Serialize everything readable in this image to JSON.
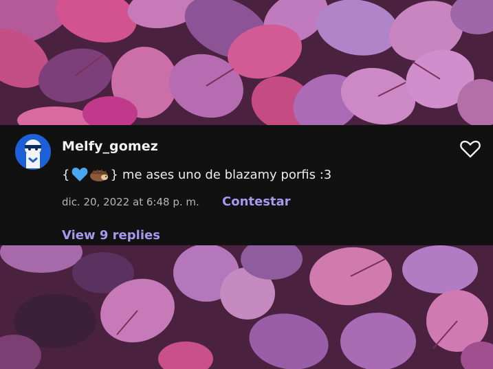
{
  "comment": {
    "username": "Melfy_gomez",
    "text_prefix": "{",
    "text_suffix": "}",
    "message": "me ases uno de blazamy porfis :3",
    "timestamp": "dic. 20, 2022 at 6:48 p. m.",
    "reply_label": "Contestar",
    "view_replies_label": "View 9 replies",
    "emojis": [
      "blue-heart-icon",
      "hedgehog-icon"
    ]
  },
  "colors": {
    "panel_bg": "#111112",
    "accent": "#a898ee",
    "leaf_light": "#c25a9c",
    "leaf_dark": "#5a2a4e"
  }
}
